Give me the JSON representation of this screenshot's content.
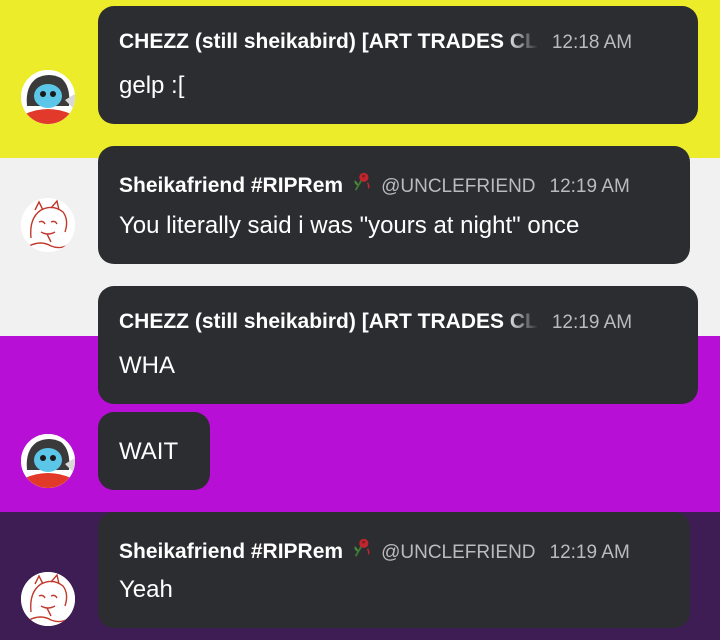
{
  "messages": [
    {
      "author": "CHEZZ (still sheikabird) [ART TRADES CL",
      "handle": "",
      "time": "12:18 AM",
      "text": "gelp :["
    },
    {
      "author": "Sheikafriend #RIPRem",
      "handle": "@UNCLEFRIEND",
      "time": "12:19 AM",
      "text": "You literally said i was \"yours at night\" once"
    },
    {
      "author": "CHEZZ (still sheikabird) [ART TRADES CL",
      "handle": "",
      "time": "12:19 AM",
      "text": "WHA"
    },
    {
      "author": "",
      "handle": "",
      "time": "",
      "text": "WAIT"
    },
    {
      "author": "Sheikafriend #RIPRem",
      "handle": "@UNCLEFRIEND",
      "time": "12:19 AM",
      "text": "Yeah"
    }
  ],
  "icons": {
    "rose": "wilted-rose-icon",
    "avatar_chezz": "chezz-avatar",
    "avatar_sheikafriend": "sheikafriend-avatar"
  },
  "colors": {
    "bubble": "#2c2d30",
    "band_yellow": "#ecec2a",
    "band_white": "#f1f1f1",
    "band_purple": "#b70fd6",
    "band_dark_purple": "#3e1d55",
    "meta_text": "#b9bbbe"
  }
}
